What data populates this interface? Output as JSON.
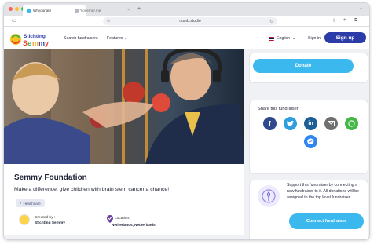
{
  "browser": {
    "tabs": [
      {
        "title": "Whydonate",
        "active": true
      },
      {
        "title": "coserner.me",
        "active": false
      }
    ],
    "url": "numb.studio"
  },
  "header": {
    "logo_text": "Stichting Semmy",
    "nav": [
      "Search fundraisers",
      "Features"
    ],
    "language": "English",
    "signin": "Sign in",
    "signup": "Sign up"
  },
  "fundraiser": {
    "title": "Semmy Foundation",
    "subtitle": "Make a difference, give children with brain stem cancer a chance!",
    "category": "Healthcare",
    "created_label": "Created by :",
    "created_by": "Stichting Semmy",
    "location_label": "Location:",
    "location": "Netherlands, Netherlands"
  },
  "sidebar": {
    "donate": "Donate",
    "share_title": "Share this fundraiser",
    "share_icons": [
      "facebook-icon",
      "twitter-icon",
      "linkedin-icon",
      "email-icon",
      "whatsapp-icon",
      "messenger-icon"
    ],
    "support_text": "Support this fundraiser by connecting a new fundraiser to it. All donations will be assigned to the top level fundraiser.",
    "connect": "Connect fundraiser"
  },
  "colors": {
    "primary": "#2b3ba8",
    "accent": "#3bb9ef",
    "page_bg": "#f0f1f4"
  }
}
